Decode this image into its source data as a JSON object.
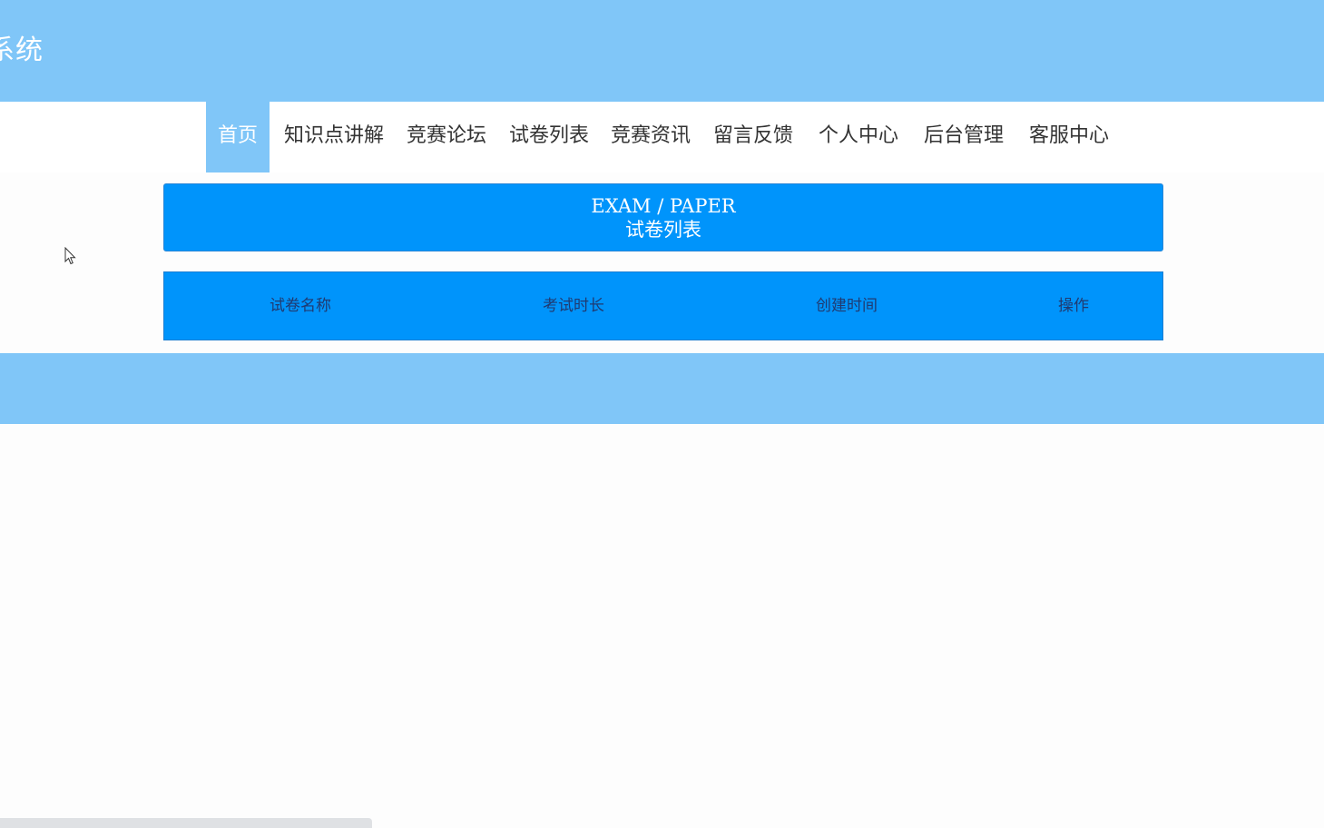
{
  "header": {
    "title": "系统"
  },
  "nav": {
    "items": [
      {
        "label": "首页",
        "active": true
      },
      {
        "label": "知识点讲解",
        "active": false
      },
      {
        "label": "竞赛论坛",
        "active": false
      },
      {
        "label": "试卷列表",
        "active": false
      },
      {
        "label": "竞赛资讯",
        "active": false
      },
      {
        "label": "留言反馈",
        "active": false
      },
      {
        "label": "个人中心",
        "active": false
      },
      {
        "label": "后台管理",
        "active": false
      },
      {
        "label": "客服中心",
        "active": false
      }
    ]
  },
  "banner": {
    "title_en": "EXAM / PAPER",
    "title_cn": "试卷列表"
  },
  "table": {
    "columns": [
      "试卷名称",
      "考试时长",
      "创建时间",
      "操作"
    ],
    "rows": []
  },
  "colors": {
    "header_bg": "#80c6f8",
    "accent": "#0094fb",
    "column_text": "#203a70",
    "nav_text": "#333333"
  }
}
